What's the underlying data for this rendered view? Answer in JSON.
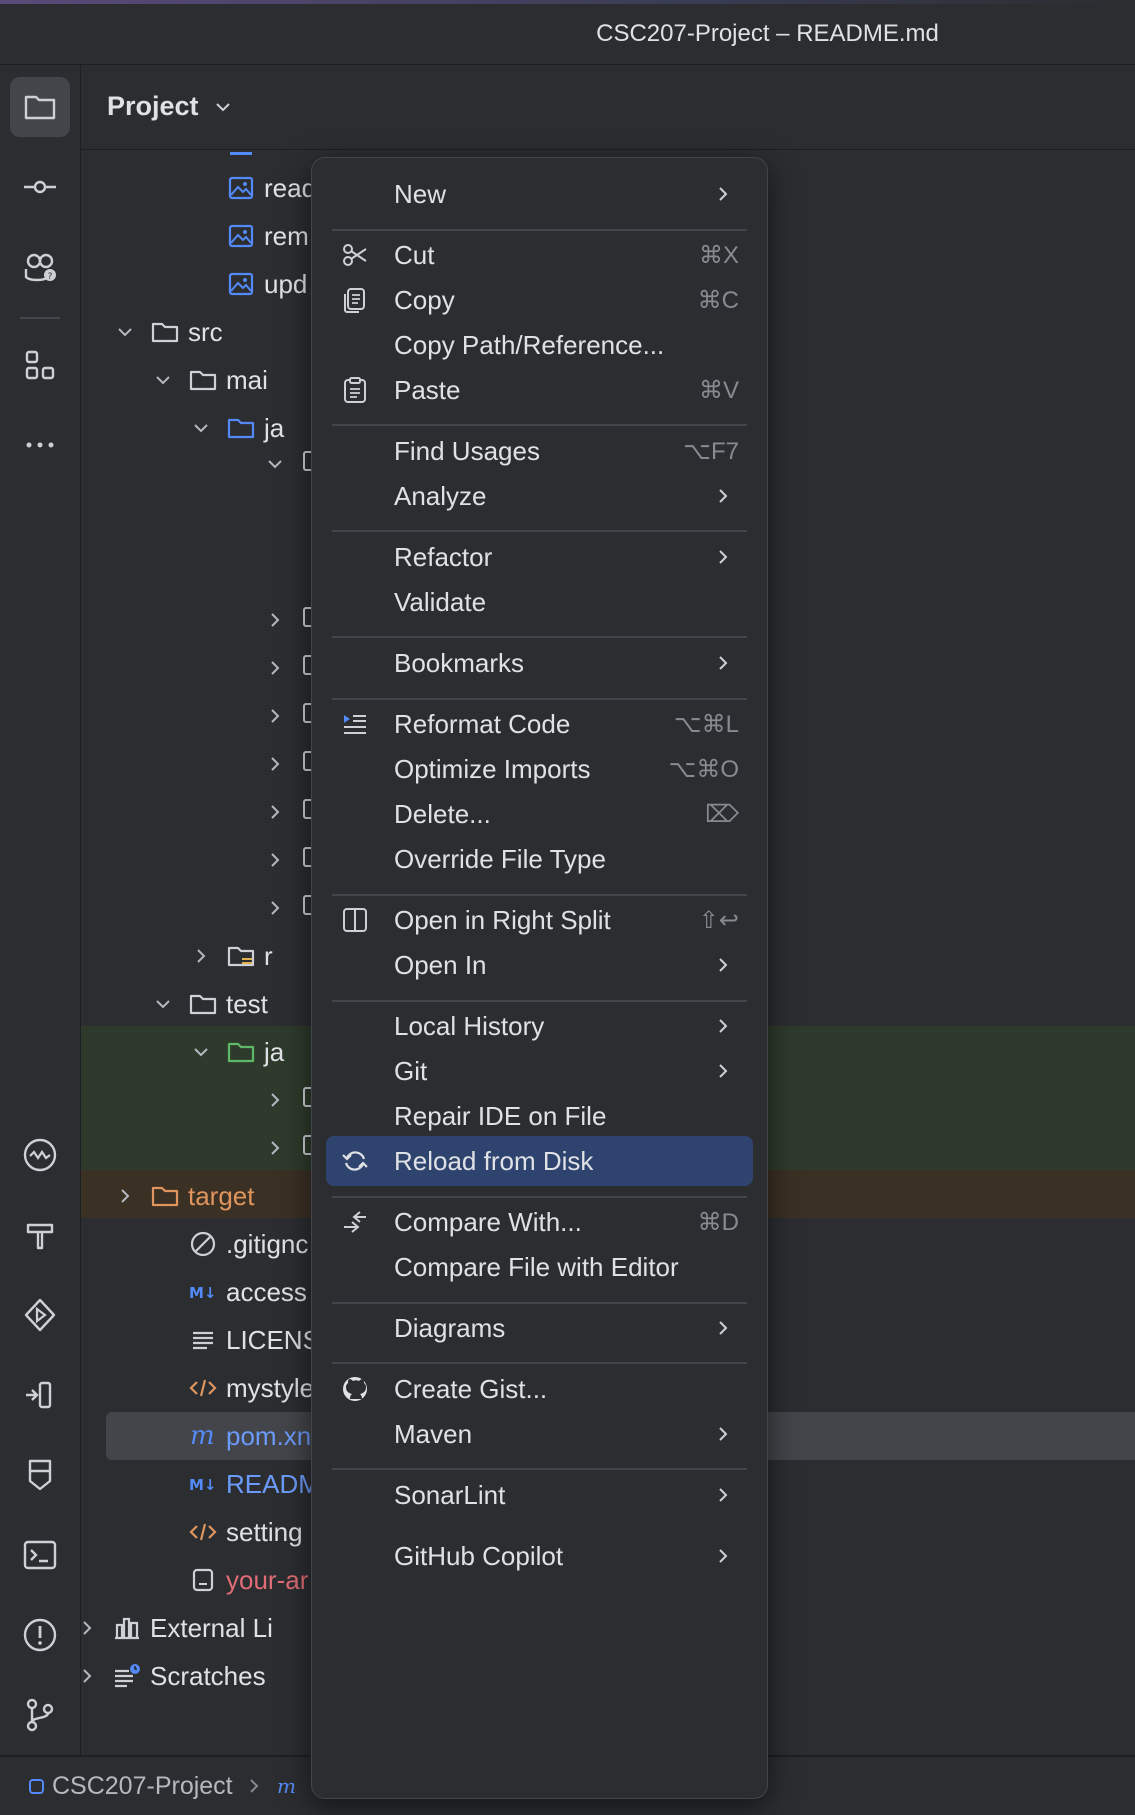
{
  "window": {
    "title": "CSC207-Project – README.md"
  },
  "panel": {
    "title": "Project"
  },
  "tree": {
    "rows": [
      {
        "label": "read",
        "icon": "image-icon",
        "color": "#dfe1e5"
      },
      {
        "label": "rem",
        "icon": "image-icon",
        "color": "#dfe1e5"
      },
      {
        "label": "upd",
        "icon": "image-icon",
        "color": "#dfe1e5"
      },
      {
        "label": "src",
        "icon": "folder-icon",
        "color": "#dfe1e5"
      },
      {
        "label": "mai",
        "icon": "folder-icon",
        "color": "#dfe1e5"
      },
      {
        "label": "ja",
        "icon": "source-folder-icon",
        "color": "#dfe1e5"
      },
      {
        "label": "r",
        "icon": "resources-folder-icon",
        "color": "#dfe1e5"
      },
      {
        "label": "test",
        "icon": "folder-icon",
        "color": "#dfe1e5"
      },
      {
        "label": "ja",
        "icon": "test-folder-icon",
        "color": "#dfe1e5"
      },
      {
        "label": "target",
        "icon": "excluded-folder-icon",
        "color": "#e0955e"
      },
      {
        "label": ".gitignc",
        "icon": "ignore-icon",
        "color": "#dfe1e5"
      },
      {
        "label": "access",
        "icon": "markdown-icon",
        "color": "#dfe1e5"
      },
      {
        "label": "LICENS",
        "icon": "text-file-icon",
        "color": "#dfe1e5"
      },
      {
        "label": "mystyle",
        "icon": "xml-icon",
        "color": "#dfe1e5"
      },
      {
        "label": "pom.xn",
        "icon": "maven-icon",
        "color": "#6b9bfa"
      },
      {
        "label": "READM",
        "icon": "markdown-icon",
        "color": "#6b9bfa"
      },
      {
        "label": "setting",
        "icon": "xml-icon",
        "color": "#dfe1e5"
      },
      {
        "label": "your-ar",
        "icon": "file-icon",
        "color": "#e06c75"
      },
      {
        "label": "External Li",
        "icon": "library-icon",
        "color": "#dfe1e5"
      },
      {
        "label": "Scratches",
        "icon": "scratches-icon",
        "color": "#dfe1e5"
      }
    ]
  },
  "menu": {
    "items": [
      {
        "label": "New",
        "shortcut": "",
        "submenu": true,
        "icon": ""
      },
      {
        "label": "Cut",
        "shortcut": "⌘X",
        "submenu": false,
        "icon": "scissors-icon"
      },
      {
        "label": "Copy",
        "shortcut": "⌘C",
        "submenu": false,
        "icon": "copy-icon"
      },
      {
        "label": "Copy Path/Reference...",
        "shortcut": "",
        "submenu": false,
        "icon": ""
      },
      {
        "label": "Paste",
        "shortcut": "⌘V",
        "submenu": false,
        "icon": "clipboard-icon"
      },
      {
        "label": "Find Usages",
        "shortcut": "⌥F7",
        "submenu": false,
        "icon": ""
      },
      {
        "label": "Analyze",
        "shortcut": "",
        "submenu": true,
        "icon": ""
      },
      {
        "label": "Refactor",
        "shortcut": "",
        "submenu": true,
        "icon": ""
      },
      {
        "label": "Validate",
        "shortcut": "",
        "submenu": false,
        "icon": ""
      },
      {
        "label": "Bookmarks",
        "shortcut": "",
        "submenu": true,
        "icon": ""
      },
      {
        "label": "Reformat Code",
        "shortcut": "⌥⌘L",
        "submenu": false,
        "icon": "reformat-icon"
      },
      {
        "label": "Optimize Imports",
        "shortcut": "⌥⌘O",
        "submenu": false,
        "icon": ""
      },
      {
        "label": "Delete...",
        "shortcut": "⌦",
        "submenu": false,
        "icon": ""
      },
      {
        "label": "Override File Type",
        "shortcut": "",
        "submenu": false,
        "icon": ""
      },
      {
        "label": "Open in Right Split",
        "shortcut": "⇧↩",
        "submenu": false,
        "icon": "split-icon"
      },
      {
        "label": "Open In",
        "shortcut": "",
        "submenu": true,
        "icon": ""
      },
      {
        "label": "Local History",
        "shortcut": "",
        "submenu": true,
        "icon": ""
      },
      {
        "label": "Git",
        "shortcut": "",
        "submenu": true,
        "icon": ""
      },
      {
        "label": "Repair IDE on File",
        "shortcut": "",
        "submenu": false,
        "icon": ""
      },
      {
        "label": "Reload from Disk",
        "shortcut": "",
        "submenu": false,
        "icon": "reload-icon",
        "selected": true
      },
      {
        "label": "Compare With...",
        "shortcut": "⌘D",
        "submenu": false,
        "icon": "compare-icon"
      },
      {
        "label": "Compare File with Editor",
        "shortcut": "",
        "submenu": false,
        "icon": ""
      },
      {
        "label": "Diagrams",
        "shortcut": "",
        "submenu": true,
        "icon": ""
      },
      {
        "label": "Create Gist...",
        "shortcut": "",
        "submenu": false,
        "icon": "github-icon"
      },
      {
        "label": "Maven",
        "shortcut": "",
        "submenu": true,
        "icon": ""
      },
      {
        "label": "SonarLint",
        "shortcut": "",
        "submenu": true,
        "icon": ""
      },
      {
        "label": "GitHub Copilot",
        "shortcut": "",
        "submenu": true,
        "icon": ""
      }
    ]
  },
  "statusbar": {
    "project": "CSC207-Project"
  },
  "colors": {
    "selection": "#2e436e",
    "accent": "#3574f0"
  }
}
